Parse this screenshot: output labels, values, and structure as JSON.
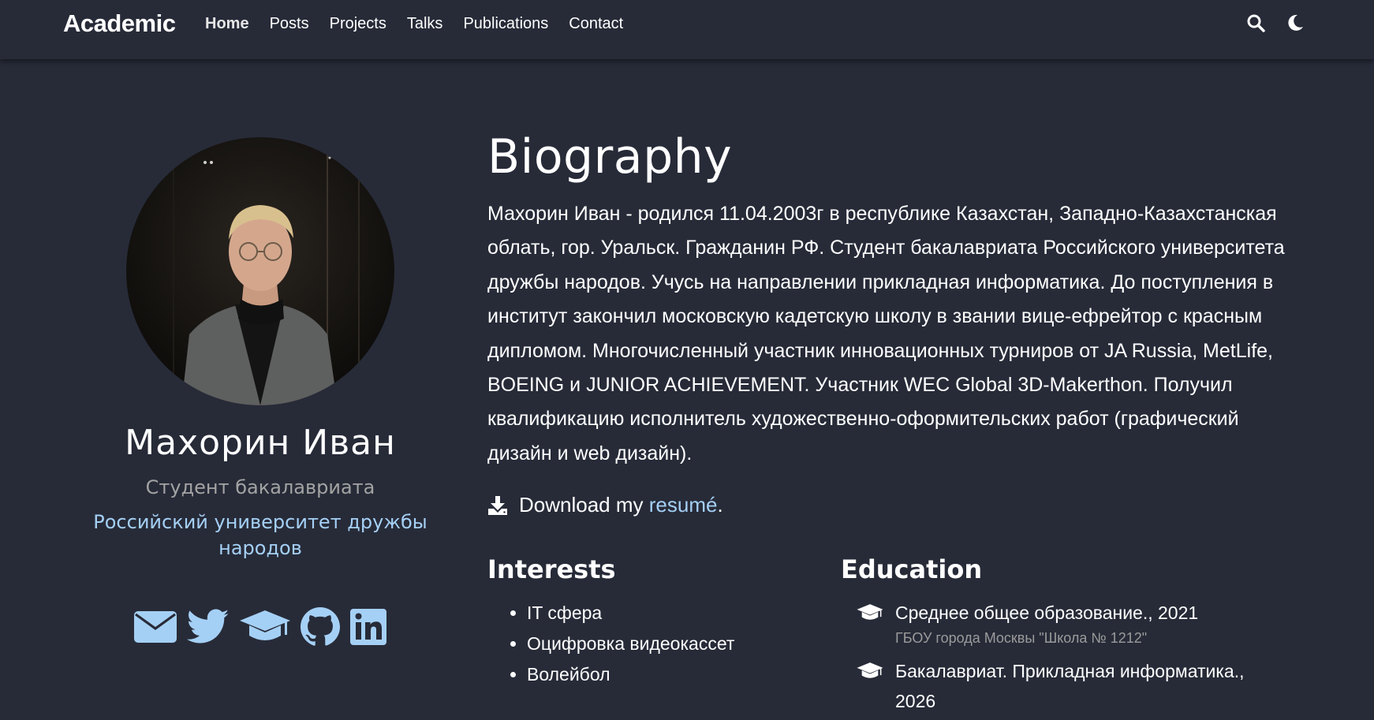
{
  "navbar": {
    "brand": "Academic",
    "links": [
      {
        "label": "Home"
      },
      {
        "label": "Posts"
      },
      {
        "label": "Projects"
      },
      {
        "label": "Talks"
      },
      {
        "label": "Publications"
      },
      {
        "label": "Contact"
      }
    ],
    "icons": [
      "search-icon",
      "moon-icon"
    ]
  },
  "profile": {
    "name": "Махорин Иван",
    "role": "Студент бакалавриата",
    "organization": "Российский университет дружбы народов",
    "social_icons": [
      "envelope-icon",
      "twitter-icon",
      "graduation-cap-icon",
      "github-icon",
      "linkedin-icon"
    ]
  },
  "biography": {
    "title": "Biography",
    "text": "Махорин Иван - родился 11.04.2003г в республике Казахстан, Западно-Казахстанская облать, гор. Уральск. Гражданин РФ. Студент бакалавриата Российского университета дружбы народов. Учусь на направлении прикладная информатика. До поступления в институт закончил московскую кадетскую школу в звании вице-ефрейтор с красным дипломом. Многочисленный участник инновационных турниров от JA Russia, MetLife, BOEING и JUNIOR ACHIEVEMENT. Участник WEC Global 3D-Makerthon. Получил квалификацию исполнитель художественно-оформительских работ (графический дизайн и web дизайн).",
    "download_prefix": "Download my",
    "download_link": "resumé",
    "download_suffix": "."
  },
  "interests": {
    "title": "Interests",
    "items": [
      "IT сфера",
      "Оцифровка видеокассет",
      "Волейбол"
    ]
  },
  "education": {
    "title": "Education",
    "items": [
      {
        "course": "Среднее общее образование., 2021",
        "institution": "ГБОУ города Москвы \"Школа № 1212\""
      },
      {
        "course": "Бакалавриат. Прикладная информатика., 2026",
        "institution": ""
      }
    ]
  },
  "colors": {
    "background": "#272b38",
    "link": "#a5d0f5",
    "muted": "#a3a3a3"
  }
}
